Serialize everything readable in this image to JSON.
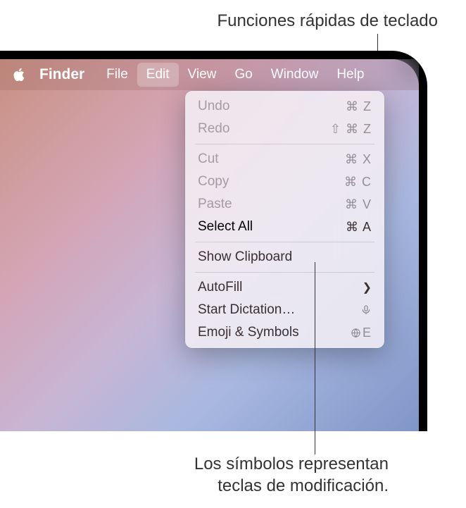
{
  "callouts": {
    "top": "Funciones rápidas de teclado",
    "bottom_line1": "Los símbolos representan",
    "bottom_line2": "teclas de modificación."
  },
  "menubar": {
    "app_name": "Finder",
    "items": [
      "File",
      "Edit",
      "View",
      "Go",
      "Window",
      "Help"
    ]
  },
  "dropdown": {
    "items": [
      {
        "label": "Undo",
        "shortcut": "⌘ Z",
        "disabled": true
      },
      {
        "label": "Redo",
        "shortcut": "⇧ ⌘ Z",
        "disabled": true
      },
      {
        "divider": true
      },
      {
        "label": "Cut",
        "shortcut": "⌘ X",
        "disabled": true
      },
      {
        "label": "Copy",
        "shortcut": "⌘ C",
        "disabled": true
      },
      {
        "label": "Paste",
        "shortcut": "⌘ V",
        "disabled": true
      },
      {
        "label": "Select All",
        "shortcut": "⌘ A",
        "disabled": false,
        "bold": true
      },
      {
        "divider": true
      },
      {
        "label": "Show Clipboard",
        "shortcut": "",
        "disabled": false
      },
      {
        "divider": true
      },
      {
        "label": "AutoFill",
        "shortcut": "",
        "submenu": true,
        "disabled": false
      },
      {
        "label": "Start Dictation…",
        "shortcut": "",
        "icon": "mic",
        "disabled": false
      },
      {
        "label": "Emoji & Symbols",
        "shortcut": "E",
        "icon": "globe",
        "disabled": false
      }
    ]
  }
}
